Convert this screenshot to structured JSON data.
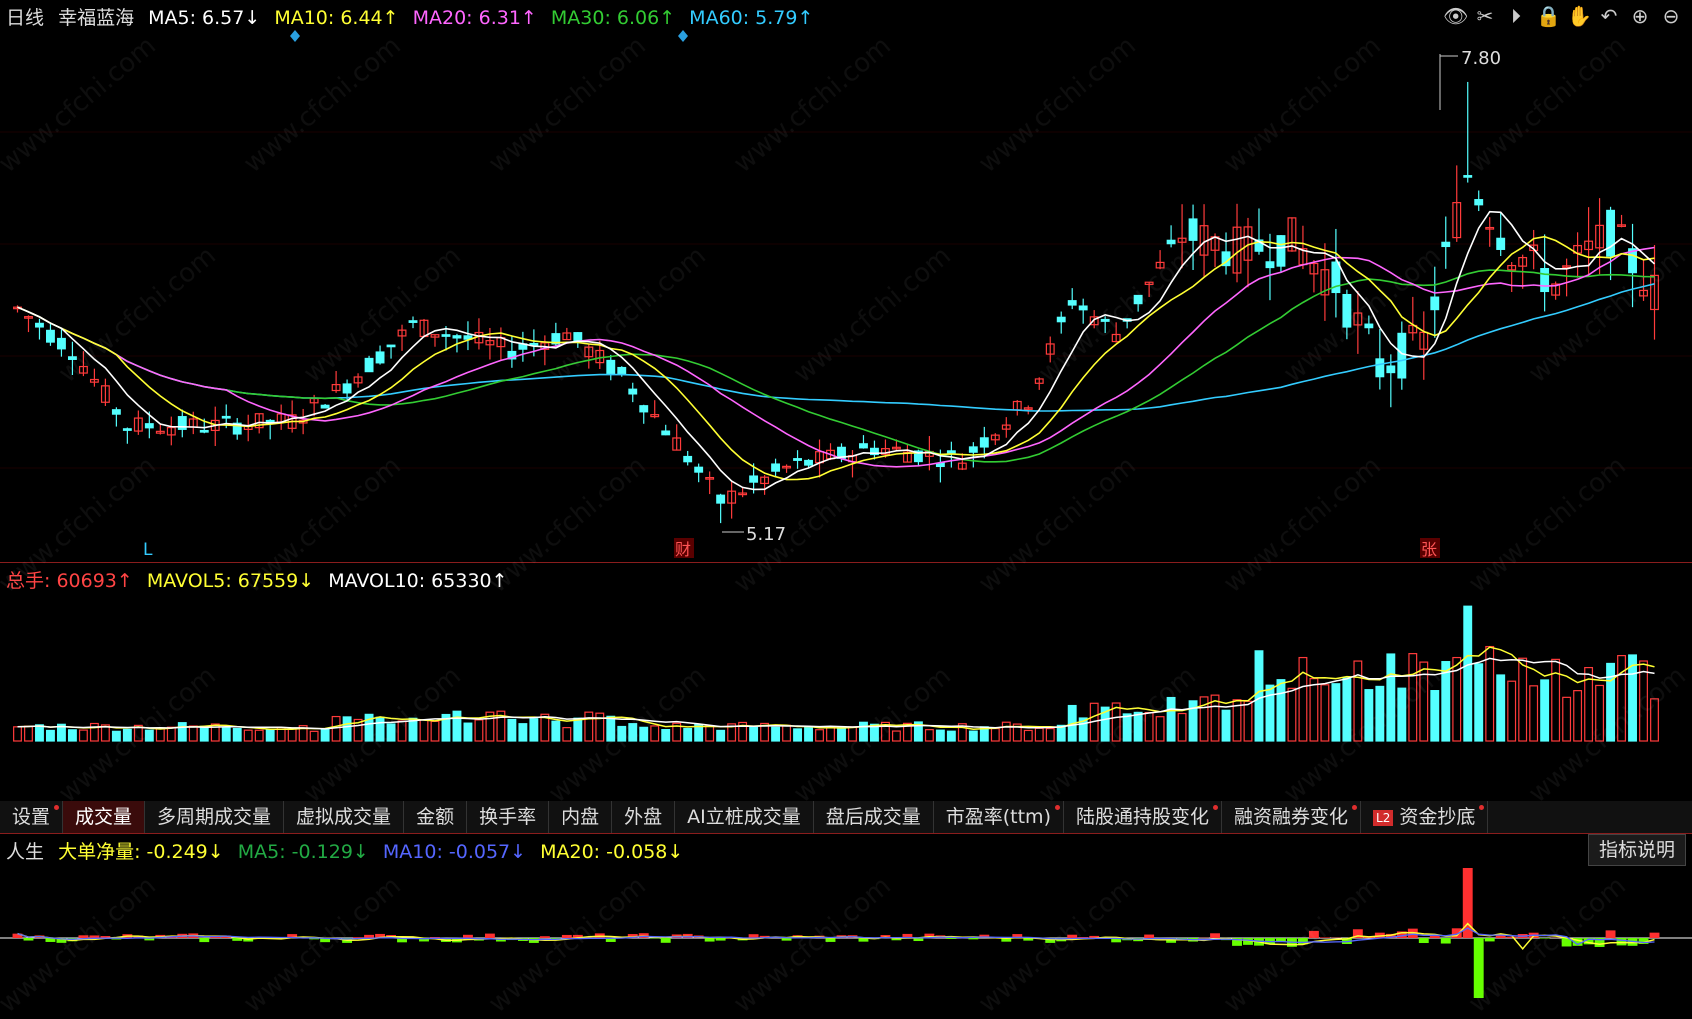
{
  "price_legend": {
    "period": "日线",
    "name": "幸福蓝海",
    "ma5": "MA5: 6.57↓",
    "ma10": "MA10: 6.44↑",
    "ma20": "MA20: 6.31↑",
    "ma30": "MA30: 6.06↑",
    "ma60": "MA60: 5.79↑"
  },
  "price_annotations": {
    "high": "7.80",
    "low": "5.17",
    "marker_l": "L",
    "marker_cai": "财",
    "marker_zhang": "张"
  },
  "volume_legend": {
    "total": "总手: 60693↑",
    "mavol5": "MAVOL5: 67559↓",
    "mavol10": "MAVOL10: 65330↑"
  },
  "tabs": [
    {
      "label": "设置",
      "dot": true
    },
    {
      "label": "成交量",
      "active": true
    },
    {
      "label": "多周期成交量"
    },
    {
      "label": "虚拟成交量"
    },
    {
      "label": "金额"
    },
    {
      "label": "换手率"
    },
    {
      "label": "内盘"
    },
    {
      "label": "外盘"
    },
    {
      "label": "AI立桩成交量"
    },
    {
      "label": "盘后成交量"
    },
    {
      "label": "市盈率(ttm)",
      "dot": true
    },
    {
      "label": "陆股通持股变化",
      "dot": true
    },
    {
      "label": "融资融券变化",
      "dot": true
    },
    {
      "label": "资金抄底",
      "badge": "L2",
      "dot": true
    }
  ],
  "indicator_legend": {
    "name": "人生",
    "big_net": "大单净量: -0.249↓",
    "ma5": "MA5: -0.129↓",
    "ma10": "MA10: -0.057↓",
    "ma20": "MA20: -0.058↓"
  },
  "indicator_help": "指标说明",
  "toolbar_icons": [
    "eye-icon",
    "scissors-icon",
    "play-icon",
    "lock-icon",
    "hand-icon",
    "undo-icon",
    "zoom-in-icon",
    "zoom-out-icon"
  ],
  "watermark": "www.cfchi.com",
  "colors": {
    "up": "#ff3b3b",
    "down": "#54ffff",
    "ma5": "#ffffff",
    "ma10": "#ffff33",
    "ma20": "#ff66ff",
    "ma30": "#33cc33",
    "ma60": "#33ccff"
  },
  "chart_data": {
    "type": "candlestick",
    "high": 7.8,
    "low": 5.17
  }
}
